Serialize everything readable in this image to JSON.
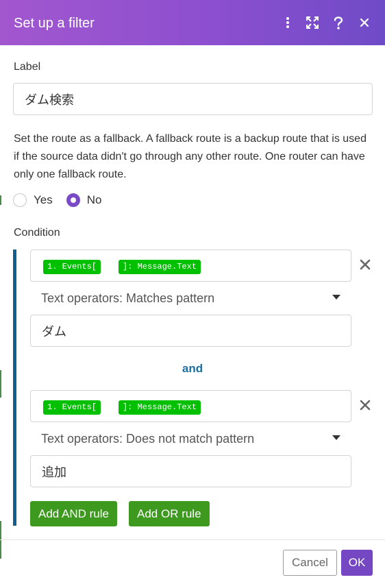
{
  "dialog": {
    "title": "Set up a filter",
    "icons": [
      "more-vertical-icon",
      "expand-icon",
      "help-icon",
      "close-icon"
    ]
  },
  "label_field": {
    "label": "Label",
    "value": "ダム検索"
  },
  "fallback": {
    "description": "Set the route as a fallback. A fallback route is a backup route that is used if the source data didn't go through any other route. One router can have only one fallback route.",
    "options": [
      "Yes",
      "No"
    ],
    "selected": "No"
  },
  "condition": {
    "label": "Condition",
    "rules": [
      {
        "pills": [
          "1. Events[",
          "]: Message.Text"
        ],
        "operator": "Text operators: Matches pattern",
        "value": "ダム"
      },
      {
        "pills": [
          "1. Events[",
          "]: Message.Text"
        ],
        "operator": "Text operators: Does not match pattern",
        "value": "追加"
      }
    ],
    "joiner": "and"
  },
  "actions": {
    "add_and": "Add AND rule",
    "add_or": "Add OR rule"
  },
  "footer": {
    "cancel": "Cancel",
    "ok": "OK"
  },
  "colors": {
    "header_start": "#a257cf",
    "header_end": "#6f4bc7",
    "pill": "#00c000",
    "green_button": "#3e9a1f",
    "ok_button": "#7547c2",
    "and_text": "#1f6fa0",
    "condition_bar": "#0f5f8f"
  }
}
